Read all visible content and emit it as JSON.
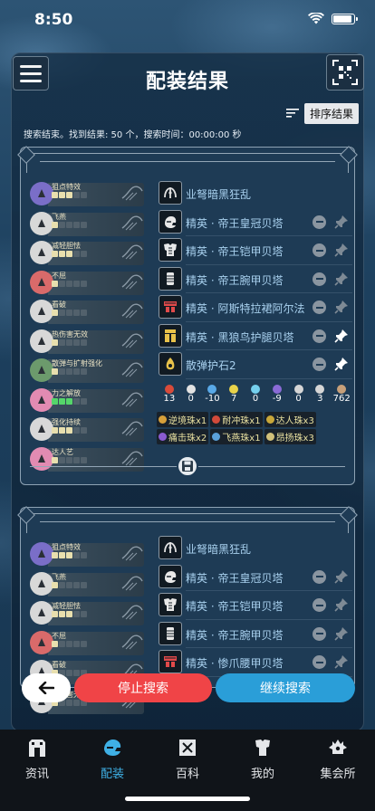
{
  "status": {
    "time": "8:50"
  },
  "header": {
    "title": "配装结果",
    "sort_label": "排序结果"
  },
  "summary": "搜索结束。找到结果: 50 个，搜索时间：00:00:00 秒",
  "cards": [
    {
      "skills": [
        {
          "name": "狙点特效",
          "color": "#7a6ec8",
          "pips": 3
        },
        {
          "name": "飞燕",
          "color": "#d8d8d8",
          "pips": 1
        },
        {
          "name": "减轻胆怯",
          "color": "#d8d8d8",
          "pips": 3
        },
        {
          "name": "不屈",
          "color": "#d96a6a",
          "pips": 1
        },
        {
          "name": "看破",
          "color": "#d8d8d8",
          "pips": 1
        },
        {
          "name": "热伤害无效",
          "color": "#d8d8d8",
          "pips": 1
        },
        {
          "name": "散弹与扩射强化",
          "color": "#6c9a6c",
          "pips": 1
        },
        {
          "name": "力之解放",
          "color": "#e28bb2",
          "pips": 3
        },
        {
          "name": "强化持续",
          "color": "#d8d8d8",
          "pips": 3
        },
        {
          "name": "达人艺",
          "color": "#e28bb2",
          "pips": 1
        }
      ],
      "gear": [
        {
          "name": "业弩暗黑狂乱",
          "icon": "weapon",
          "actions": false
        },
        {
          "name": "精英 · 帝王皇冠贝塔",
          "icon": "helm",
          "actions": true,
          "pinned": false
        },
        {
          "name": "精英 · 帝王铠甲贝塔",
          "icon": "chest",
          "actions": true,
          "pinned": false
        },
        {
          "name": "精英 · 帝王腕甲贝塔",
          "icon": "arms",
          "actions": true,
          "pinned": false
        },
        {
          "name": "精英 · 阿斯特拉裙阿尔法",
          "icon": "waist",
          "actions": true,
          "pinned": false
        },
        {
          "name": "精英 · 黑狼鸟护腿贝塔",
          "icon": "legs",
          "actions": true,
          "pinned": true
        },
        {
          "name": "散弹护石2",
          "icon": "charm",
          "actions": true,
          "pinned": true
        }
      ],
      "stats": [
        {
          "value": "13",
          "color": "#d94b3a"
        },
        {
          "value": "0",
          "color": "#e2e2e2"
        },
        {
          "value": "-10",
          "color": "#59a9e8"
        },
        {
          "value": "7",
          "color": "#e9d34a"
        },
        {
          "value": "0",
          "color": "#75d0ee"
        },
        {
          "value": "-9",
          "color": "#8a6bd6"
        },
        {
          "value": "0",
          "color": "#d6d6d6"
        },
        {
          "value": "3",
          "color": "#d6d6d6"
        },
        {
          "value": "762",
          "color": "#c7a07a"
        }
      ],
      "decos": [
        {
          "label": "逆境珠x1",
          "color": "#d7a03a"
        },
        {
          "label": "耐冲珠x1",
          "color": "#d24a3a"
        },
        {
          "label": "达人珠x3",
          "color": "#c8a73a"
        },
        {
          "label": "痛击珠x2",
          "color": "#8a5bd0"
        },
        {
          "label": "飞燕珠x1",
          "color": "#5aa0d8"
        },
        {
          "label": "昂扬珠x3",
          "color": "#d0c07a"
        }
      ]
    },
    {
      "skills": [
        {
          "name": "狙点特效",
          "color": "#7a6ec8",
          "pips": 3
        },
        {
          "name": "飞燕",
          "color": "#d8d8d8",
          "pips": 1
        },
        {
          "name": "减轻胆怯",
          "color": "#d8d8d8",
          "pips": 3
        },
        {
          "name": "不屈",
          "color": "#d96a6a",
          "pips": 1
        },
        {
          "name": "看破",
          "color": "#d8d8d8",
          "pips": 1
        },
        {
          "name": "热伤害无效",
          "color": "#d8d8d8",
          "pips": 1
        }
      ],
      "gear": [
        {
          "name": "业弩暗黑狂乱",
          "icon": "weapon",
          "actions": false
        },
        {
          "name": "精英 · 帝王皇冠贝塔",
          "icon": "helm",
          "actions": true,
          "pinned": false
        },
        {
          "name": "精英 · 帝王铠甲贝塔",
          "icon": "chest",
          "actions": true,
          "pinned": false
        },
        {
          "name": "精英 · 帝王腕甲贝塔",
          "icon": "arms",
          "actions": true,
          "pinned": false
        },
        {
          "name": "精英 · 惨爪腰甲贝塔",
          "icon": "waist",
          "actions": true,
          "pinned": false
        }
      ]
    }
  ],
  "actions": {
    "stop": "停止搜索",
    "continue": "继续搜索"
  },
  "tabs": [
    {
      "label": "资讯",
      "icon": "gate-icon"
    },
    {
      "label": "配装",
      "icon": "helmet-icon",
      "active": true
    },
    {
      "label": "百科",
      "icon": "book-icon"
    },
    {
      "label": "我的",
      "icon": "armor-icon"
    },
    {
      "label": "集会所",
      "icon": "guild-icon"
    }
  ]
}
